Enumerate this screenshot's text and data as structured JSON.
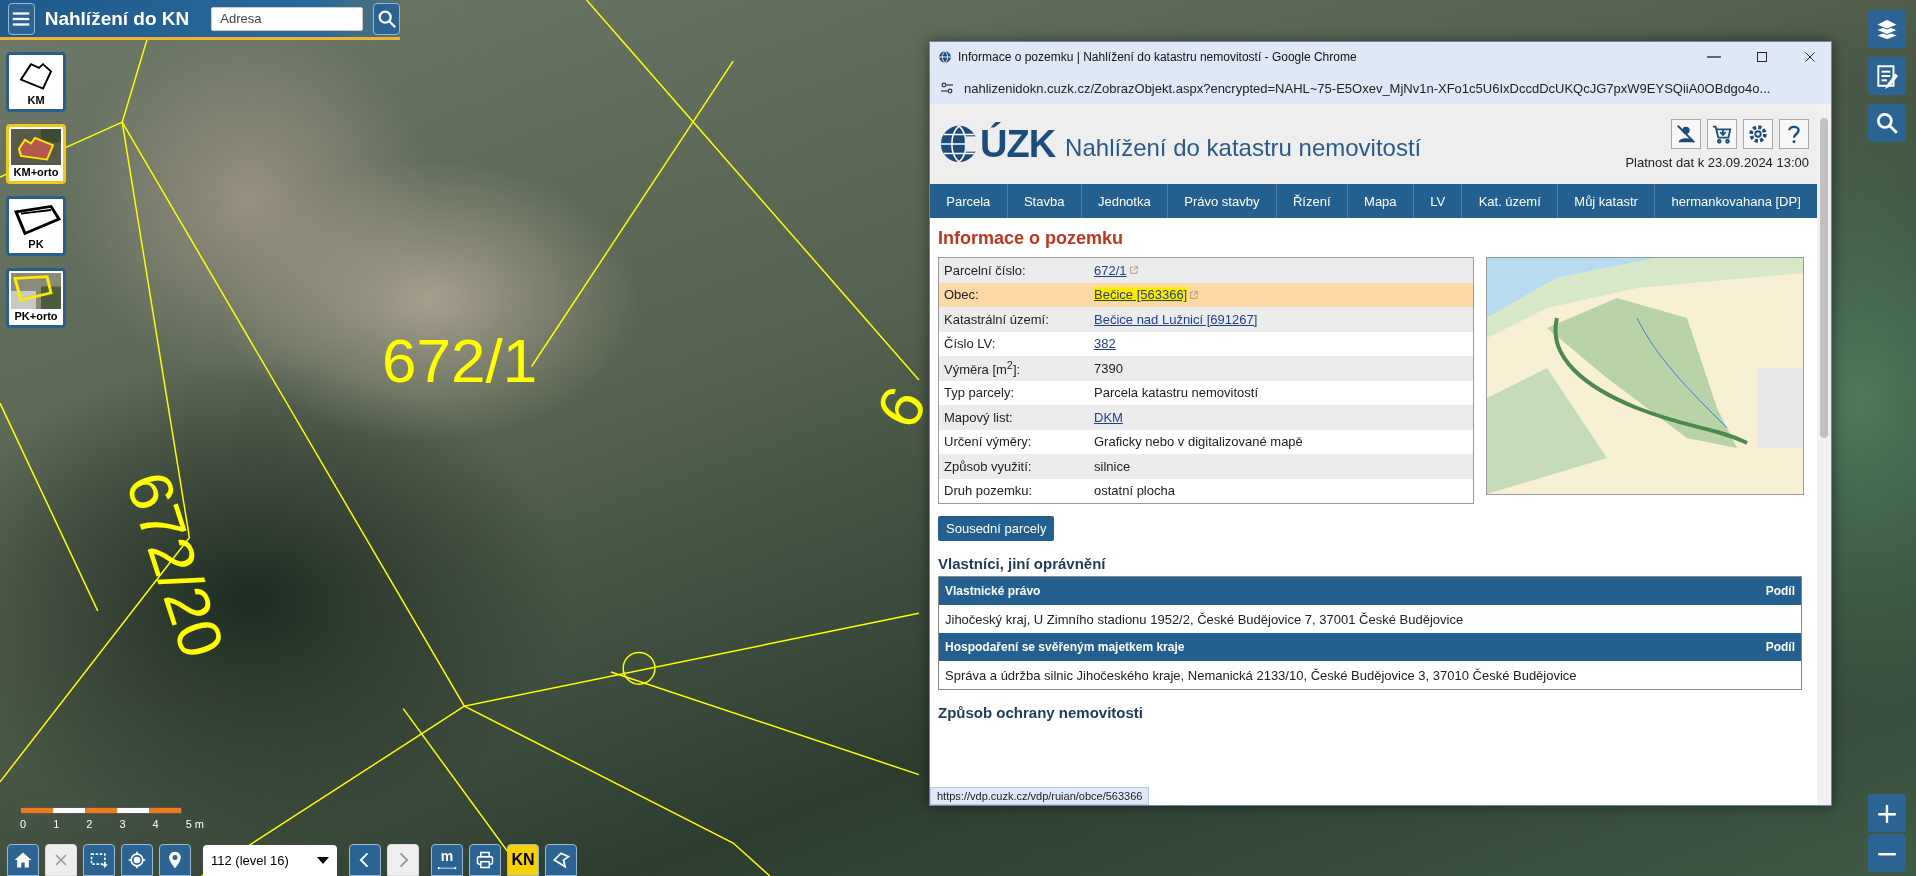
{
  "app_header": {
    "title": "Nahlížení do KN",
    "search": {
      "placeholder": "Adresa"
    }
  },
  "layers": [
    {
      "label": "KM",
      "kind": "km",
      "selected": false
    },
    {
      "label": "KM+orto",
      "kind": "km-orto",
      "selected": true
    },
    {
      "label": "PK",
      "kind": "pk",
      "selected": false
    },
    {
      "label": "PK+orto",
      "kind": "pk-orto",
      "selected": false
    }
  ],
  "map_labels": [
    {
      "text": "672/1"
    },
    {
      "text": "672/20"
    },
    {
      "text": "6"
    }
  ],
  "right_tools": [
    {
      "kind": "layers"
    },
    {
      "kind": "list"
    },
    {
      "kind": "search"
    }
  ],
  "zoom_controls": [
    {
      "label": "+"
    },
    {
      "label": "−"
    }
  ],
  "scale_bar": {
    "labels": [
      "0",
      "1",
      "2",
      "3",
      "4",
      "5 m"
    ]
  },
  "bottom_toolbar": [
    {
      "kind": "home",
      "disabled": false
    },
    {
      "kind": "clear",
      "disabled": true
    },
    {
      "kind": "select-area",
      "disabled": false
    },
    {
      "kind": "locate",
      "disabled": false
    },
    {
      "kind": "pin",
      "disabled": false
    },
    {
      "kind": "dropdown",
      "value": "112 (level 16)"
    },
    {
      "kind": "prev",
      "disabled": false
    },
    {
      "kind": "next",
      "disabled": true
    },
    {
      "kind": "measure",
      "label": "m",
      "disabled": false
    },
    {
      "kind": "print",
      "disabled": false
    },
    {
      "kind": "kn",
      "label": "KN",
      "disabled": false
    },
    {
      "kind": "shape",
      "disabled": false
    }
  ],
  "browser_window": {
    "title": "Informace o pozemku | Nahlížení do katastru nemovitostí - Google Chrome",
    "url": "nahlizenidokn.cuzk.cz/ZobrazObjekt.aspx?encrypted=NAHL~75-E5Oxev_MjNv1n-XFo1c5U6IxDccdDcUKQcJG7pxW9EYSQiiA0OBdgo4o...",
    "status_url": "https://vdp.cuzk.cz/vdp/ruian/obce/563366"
  },
  "site": {
    "logo": "ÚZK",
    "title": "Nahlížení do katastru nemovitostí",
    "validity": "Platnost dat k 23.09.2024 13:00",
    "tools": [
      {
        "kind": "user-off"
      },
      {
        "kind": "cart"
      },
      {
        "kind": "settings"
      },
      {
        "kind": "help"
      }
    ]
  },
  "nav": [
    {
      "label": "Parcela"
    },
    {
      "label": "Stavba"
    },
    {
      "label": "Jednotka"
    },
    {
      "label": "Právo stavby"
    },
    {
      "label": "Řízení"
    },
    {
      "label": "Mapa"
    },
    {
      "label": "LV"
    },
    {
      "label": "Kat. území"
    },
    {
      "label": "Můj katastr"
    },
    {
      "label": "hermankovahana [DP]"
    }
  ],
  "parcel_info": {
    "heading": "Informace o pozemku",
    "rows": [
      {
        "label": "Parcelní číslo:",
        "value": "672/1",
        "link": true,
        "external": true,
        "highlighted": false
      },
      {
        "label": "Obec:",
        "value": "Bečice [563366]",
        "link": true,
        "external": true,
        "highlighted": true
      },
      {
        "label": "Katastrální území:",
        "value": "Bečice nad Lužnicí [691267]",
        "link": true,
        "external": false,
        "highlighted": false
      },
      {
        "label": "Číslo LV:",
        "value": "382",
        "link": true,
        "external": false,
        "highlighted": false
      },
      {
        "label": "Výměra [m$^{2}$]:",
        "value": "7390",
        "link": false,
        "external": false,
        "highlighted": false
      },
      {
        "label": "Typ parcely:",
        "value": "Parcela katastru nemovitostí",
        "link": false,
        "external": false,
        "highlighted": false
      },
      {
        "label": "Mapový list:",
        "value": "DKM",
        "link": true,
        "external": false,
        "highlighted": false
      },
      {
        "label": "Určení výměry:",
        "value": "Graficky nebo v digitalizované mapě",
        "link": false,
        "external": false,
        "highlighted": false
      },
      {
        "label": "Způsob využití:",
        "value": "silnice",
        "link": false,
        "external": false,
        "highlighted": false
      },
      {
        "label": "Druh pozemku:",
        "value": "ostatní plocha",
        "link": false,
        "external": false,
        "highlighted": false
      }
    ]
  },
  "neighbors_button": "Sousední parcely",
  "owners": {
    "heading": "Vlastníci, jiní oprávnění",
    "groups": [
      {
        "title": "Vlastnické právo",
        "share": "Podíl",
        "entries": [
          "Jihočeský kraj, U Zimního stadionu 1952/2, České Budějovice 7, 37001 České Budějovice"
        ]
      },
      {
        "title": "Hospodaření se svěřeným majetkem kraje",
        "share": "Podíl",
        "entries": [
          "Správa a údržba silnic Jihočeského kraje, Nemanická 2133/10, České Budějovice 3, 37010 České Budějovice"
        ]
      }
    ]
  },
  "next_heading": "Způsob ochrany nemovitosti"
}
